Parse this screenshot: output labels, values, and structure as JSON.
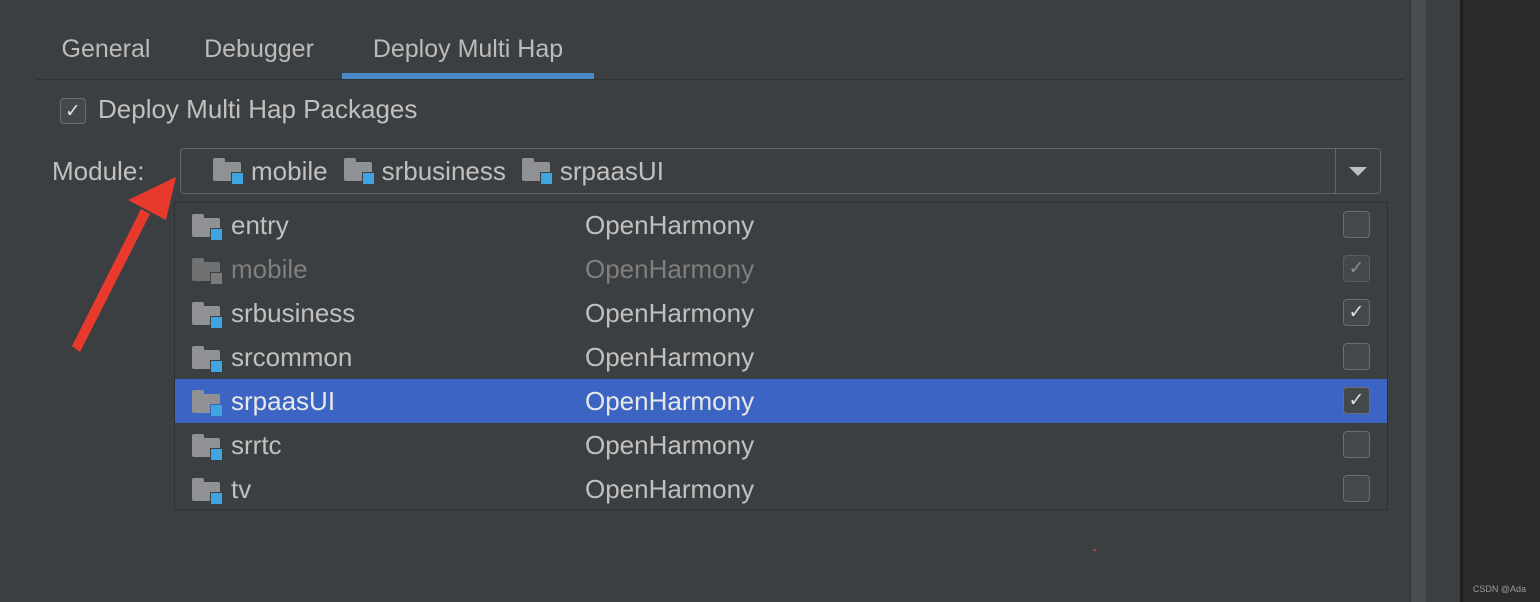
{
  "tabs": [
    {
      "label": "General",
      "active": false
    },
    {
      "label": "Debugger",
      "active": false
    },
    {
      "label": "Deploy Multi Hap",
      "active": true
    }
  ],
  "deploy_option": {
    "label": "Deploy Multi Hap Packages",
    "checked": true
  },
  "module": {
    "label": "Module:",
    "selected_chips": [
      "mobile",
      "srbusiness",
      "srpaasUI"
    ]
  },
  "popup": {
    "rows": [
      {
        "name": "entry",
        "type": "OpenHarmony",
        "checked": false,
        "disabled": false,
        "selected": false
      },
      {
        "name": "mobile",
        "type": "OpenHarmony",
        "checked": true,
        "disabled": true,
        "selected": false
      },
      {
        "name": "srbusiness",
        "type": "OpenHarmony",
        "checked": true,
        "disabled": false,
        "selected": false
      },
      {
        "name": "srcommon",
        "type": "OpenHarmony",
        "checked": false,
        "disabled": false,
        "selected": false
      },
      {
        "name": "srpaasUI",
        "type": "OpenHarmony",
        "checked": true,
        "disabled": false,
        "selected": true
      },
      {
        "name": "srrtc",
        "type": "OpenHarmony",
        "checked": false,
        "disabled": false,
        "selected": false
      },
      {
        "name": "tv",
        "type": "OpenHarmony",
        "checked": false,
        "disabled": false,
        "selected": false
      }
    ]
  },
  "icons": {
    "module_folder": "module-folder-icon",
    "dropdown": "chevron-down-icon",
    "checkmark": "checkmark-icon"
  },
  "colors": {
    "accent": "#4a88c7",
    "selection": "#3c64c2",
    "module_badge": "#3fa4e0",
    "annotation": "#e8392d"
  },
  "watermark": "CSDN @Ada"
}
